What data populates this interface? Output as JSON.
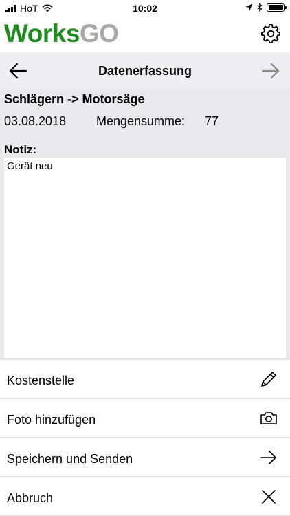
{
  "status_bar": {
    "carrier": "HoT",
    "time": "10:02"
  },
  "app": {
    "logo_part1": "Works",
    "logo_part2": "GO",
    "logo_part1_color": "#1f8a1f",
    "logo_part2_color": "#a8a8a8"
  },
  "nav": {
    "title": "Datenerfassung",
    "back_icon": "arrow-left-icon",
    "forward_icon": "arrow-right-icon"
  },
  "record": {
    "route": "Schlägern -> Motorsäge",
    "date": "03.08.2018",
    "sum_label": "Mengensumme:",
    "sum_value": "77",
    "note_label": "Notiz:",
    "note_text": "Gerät neu"
  },
  "actions": [
    {
      "label": "Kostenstelle",
      "icon": "pencil-icon"
    },
    {
      "label": "Foto hinzufügen",
      "icon": "camera-icon"
    },
    {
      "label": "Speichern und Senden",
      "icon": "arrow-right-icon"
    },
    {
      "label": "Abbruch",
      "icon": "close-icon"
    }
  ]
}
